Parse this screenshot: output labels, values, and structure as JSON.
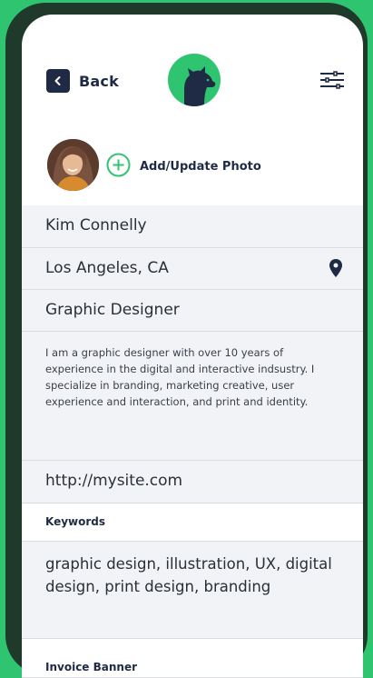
{
  "header": {
    "back_label": "Back"
  },
  "profile": {
    "add_photo_label": "Add/Update Photo",
    "name": "Kim Connelly",
    "location": "Los Angeles, CA",
    "title": "Graphic Designer",
    "bio": "I am a graphic designer with over 10 years of experience in the digital and interactive indsustry. I specialize in branding, marketing creative, user experience and interaction, and print and identity.",
    "website": "http://mysite.com"
  },
  "keywords": {
    "label": "Keywords",
    "value": "graphic design, illustration, UX, digital design, print design, branding"
  },
  "invoice": {
    "label": "Invoice Banner"
  },
  "icons": {
    "back": "chevron-left-icon",
    "logo": "dog-logo-icon",
    "menu": "sliders-menu-icon",
    "add_photo": "plus-circle-icon",
    "location": "map-pin-icon"
  },
  "colors": {
    "brand_green": "#2fc46f",
    "navy": "#1f2a44",
    "field_bg": "#f1f3f6"
  }
}
